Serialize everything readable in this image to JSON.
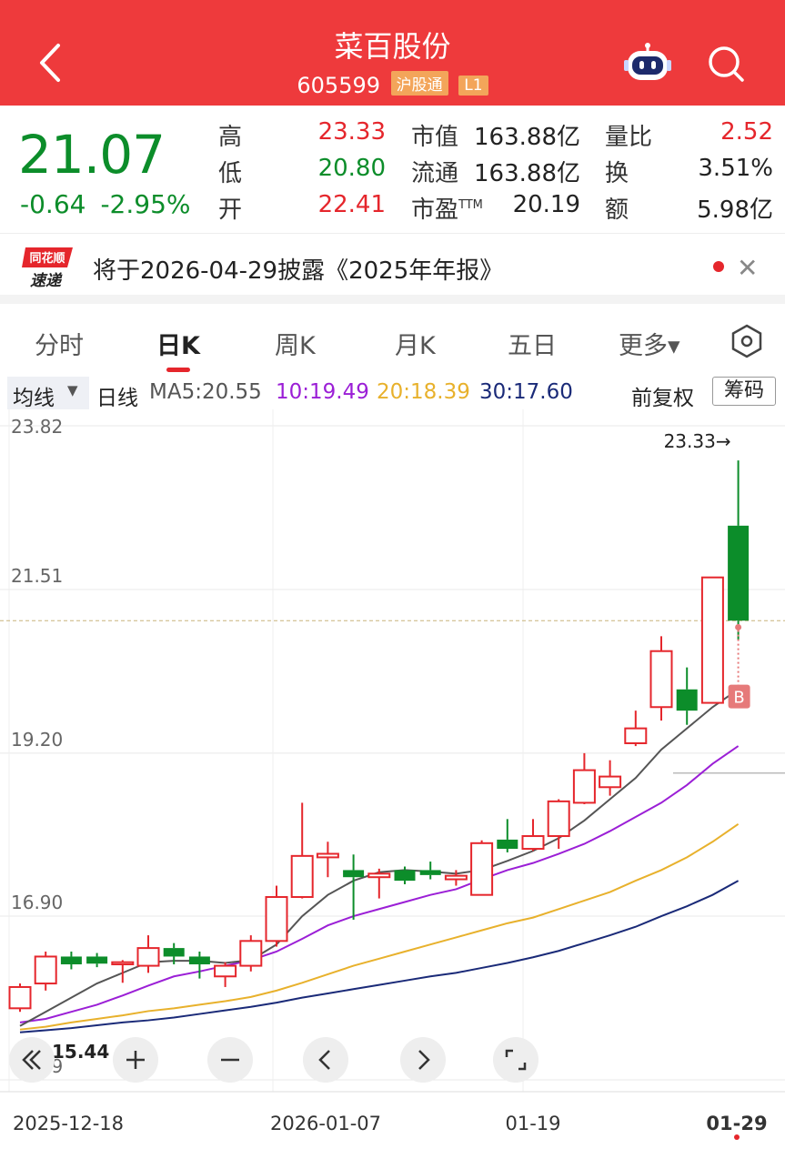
{
  "header": {
    "title": "菜百股份",
    "code": "605599",
    "tag_hgt": "沪股通",
    "tag_level": "L1"
  },
  "quote": {
    "price": "21.07",
    "change": "-0.64",
    "change_pct": "-2.95%",
    "high_label": "高",
    "high": "23.33",
    "low_label": "低",
    "low": "20.80",
    "open_label": "开",
    "open": "22.41",
    "mktcap_label": "市值",
    "mktcap": "163.88亿",
    "float_label": "流通",
    "float": "163.88亿",
    "pe_label": "市盈",
    "pe_suffix": "TTM",
    "pe": "20.19",
    "volratio_label": "量比",
    "volratio": "2.52",
    "turnover_label": "换",
    "turnover": "3.51%",
    "amount_label": "额",
    "amount": "5.98亿"
  },
  "news": {
    "logo_top": "同花顺",
    "logo_bottom": "速递",
    "text": "将于2026-04-29披露《2025年年报》"
  },
  "tabs": [
    "分时",
    "日K",
    "周K",
    "月K",
    "五日",
    "更多▾"
  ],
  "active_tab": "日K",
  "ma_bar": {
    "selector": "均线",
    "period": "日线",
    "ma5": "MA5:20.55",
    "ma10": "10:19.49",
    "ma20": "20:18.39",
    "ma30": "30:17.60",
    "adjust": "前复权",
    "chips": "筹码"
  },
  "colors": {
    "header_bg": "#ee3a3c",
    "up": "#e5262c",
    "down": "#0c8d2a",
    "ma5": "#555555",
    "ma10": "#9b1fd6",
    "ma20": "#e8b12c",
    "ma30": "#1a2a78"
  },
  "chart_data": {
    "type": "candlestick",
    "y_ticks": [
      "23.82",
      "21.51",
      "19.20",
      "16.90",
      "14.59"
    ],
    "ylim": [
      14.59,
      23.82
    ],
    "x_ticks": [
      "2025-12-18",
      "2026-01-07",
      "01-19",
      "01-29"
    ],
    "x_tick_index": [
      0,
      11,
      20,
      29
    ],
    "max_marker": "23.33→",
    "last_close_ref": 21.07,
    "buy_marker": "B",
    "min_label": "15.44",
    "candles": [
      {
        "o": 15.6,
        "h": 15.95,
        "l": 15.55,
        "c": 15.9
      },
      {
        "o": 15.95,
        "h": 16.4,
        "l": 15.85,
        "c": 16.33
      },
      {
        "o": 16.33,
        "h": 16.4,
        "l": 16.15,
        "c": 16.22
      },
      {
        "o": 16.33,
        "h": 16.38,
        "l": 16.18,
        "c": 16.23
      },
      {
        "o": 16.22,
        "h": 16.28,
        "l": 15.96,
        "c": 16.25
      },
      {
        "o": 16.2,
        "h": 16.63,
        "l": 16.1,
        "c": 16.45
      },
      {
        "o": 16.45,
        "h": 16.52,
        "l": 16.22,
        "c": 16.33
      },
      {
        "o": 16.33,
        "h": 16.4,
        "l": 16.02,
        "c": 16.22
      },
      {
        "o": 16.05,
        "h": 16.25,
        "l": 15.9,
        "c": 16.2
      },
      {
        "o": 16.2,
        "h": 16.63,
        "l": 16.12,
        "c": 16.55
      },
      {
        "o": 16.55,
        "h": 17.33,
        "l": 16.47,
        "c": 17.17
      },
      {
        "o": 17.17,
        "h": 18.5,
        "l": 17.15,
        "c": 17.75
      },
      {
        "o": 17.73,
        "h": 17.95,
        "l": 17.45,
        "c": 17.78
      },
      {
        "o": 17.55,
        "h": 17.77,
        "l": 16.85,
        "c": 17.45
      },
      {
        "o": 17.45,
        "h": 17.57,
        "l": 17.15,
        "c": 17.5
      },
      {
        "o": 17.55,
        "h": 17.6,
        "l": 17.35,
        "c": 17.4
      },
      {
        "o": 17.55,
        "h": 17.67,
        "l": 17.42,
        "c": 17.48
      },
      {
        "o": 17.42,
        "h": 17.55,
        "l": 17.33,
        "c": 17.47
      },
      {
        "o": 17.2,
        "h": 17.97,
        "l": 17.2,
        "c": 17.93
      },
      {
        "o": 17.98,
        "h": 18.27,
        "l": 17.8,
        "c": 17.85
      },
      {
        "o": 17.85,
        "h": 18.27,
        "l": 17.82,
        "c": 18.03
      },
      {
        "o": 18.03,
        "h": 18.55,
        "l": 17.85,
        "c": 18.52
      },
      {
        "o": 18.5,
        "h": 19.2,
        "l": 18.48,
        "c": 18.96
      },
      {
        "o": 18.72,
        "h": 19.1,
        "l": 18.6,
        "c": 18.87
      },
      {
        "o": 19.34,
        "h": 19.8,
        "l": 19.3,
        "c": 19.55
      },
      {
        "o": 19.85,
        "h": 20.85,
        "l": 19.66,
        "c": 20.64
      },
      {
        "o": 20.1,
        "h": 20.41,
        "l": 19.6,
        "c": 19.8
      },
      {
        "o": 19.91,
        "h": 21.68,
        "l": 19.91,
        "c": 21.68
      },
      {
        "o": 22.41,
        "h": 23.33,
        "l": 20.8,
        "c": 21.07
      }
    ],
    "ma5": [
      15.35,
      15.55,
      15.75,
      15.95,
      16.1,
      16.25,
      16.27,
      16.27,
      16.24,
      16.28,
      16.5,
      16.9,
      17.2,
      17.4,
      17.52,
      17.55,
      17.53,
      17.5,
      17.55,
      17.68,
      17.82,
      18.0,
      18.25,
      18.55,
      18.85,
      19.25,
      19.55,
      19.85,
      20.1
    ],
    "ma10": [
      15.4,
      15.45,
      15.55,
      15.65,
      15.78,
      15.92,
      16.05,
      16.12,
      16.2,
      16.28,
      16.4,
      16.58,
      16.77,
      16.9,
      17.0,
      17.1,
      17.2,
      17.28,
      17.42,
      17.55,
      17.65,
      17.78,
      17.92,
      18.1,
      18.3,
      18.5,
      18.75,
      19.05,
      19.3
    ],
    "ma20": [
      15.3,
      15.34,
      15.4,
      15.45,
      15.5,
      15.56,
      15.6,
      15.65,
      15.7,
      15.76,
      15.85,
      15.96,
      16.08,
      16.2,
      16.3,
      16.4,
      16.5,
      16.6,
      16.7,
      16.8,
      16.88,
      17.0,
      17.12,
      17.24,
      17.4,
      17.55,
      17.73,
      17.95,
      18.2
    ],
    "ma30": [
      15.26,
      15.29,
      15.32,
      15.36,
      15.4,
      15.43,
      15.47,
      15.52,
      15.57,
      15.62,
      15.68,
      15.75,
      15.81,
      15.87,
      15.93,
      15.99,
      16.05,
      16.1,
      16.17,
      16.24,
      16.32,
      16.41,
      16.52,
      16.63,
      16.75,
      16.9,
      17.04,
      17.2,
      17.4
    ]
  }
}
